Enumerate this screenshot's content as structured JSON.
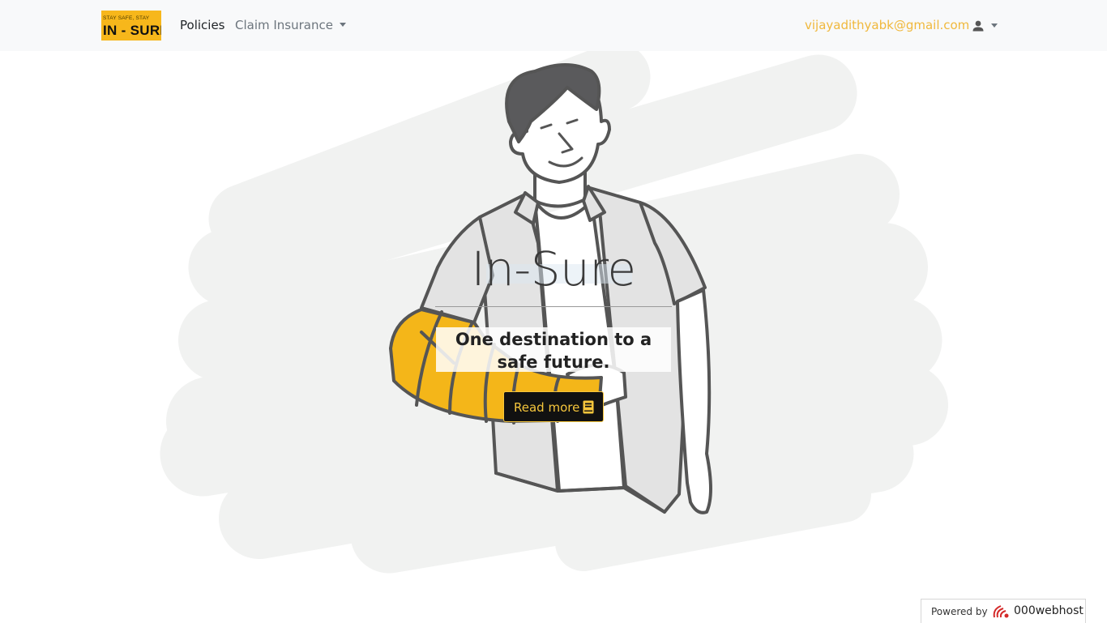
{
  "nav": {
    "brand_tagline": "STAY SAFE, STAY",
    "brand_name": "IN - SURE",
    "policies_label": "Policies",
    "claim_label": "Claim Insurance",
    "user_email": "vijayadithyabk@gmail.com",
    "user_icon": "user-icon"
  },
  "hero": {
    "title": "In-Sure",
    "tagline": "One destination to a safe future.",
    "cta_label": "Read more",
    "cta_icon": "book-icon"
  },
  "footer": {
    "powered_by": "Powered by",
    "host_name": "000webhost"
  },
  "colors": {
    "accent": "#f6c63c",
    "brand_yellow": "#f7b71b",
    "cast_yellow": "#f4b619",
    "email": "#f0b83c",
    "button_bg": "#111111"
  }
}
